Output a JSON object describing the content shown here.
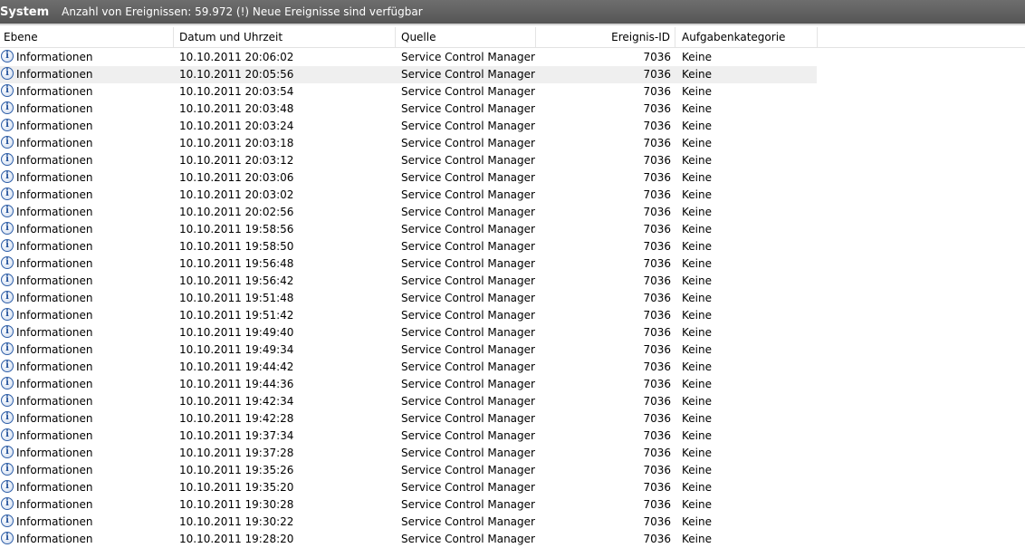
{
  "titlebar": {
    "title": "System",
    "count_text": "Anzahl von Ereignissen: 59.972 (!) Neue Ereignisse sind verfügbar"
  },
  "columns": {
    "level": "Ebene",
    "datetime": "Datum und Uhrzeit",
    "source": "Quelle",
    "event_id": "Ereignis-ID",
    "category": "Aufgabenkategorie"
  },
  "rows": [
    {
      "level": "Informationen",
      "datetime": "10.10.2011 20:06:02",
      "source": "Service Control Manager",
      "event_id": "7036",
      "category": "Keine"
    },
    {
      "level": "Informationen",
      "datetime": "10.10.2011 20:05:56",
      "source": "Service Control Manager",
      "event_id": "7036",
      "category": "Keine"
    },
    {
      "level": "Informationen",
      "datetime": "10.10.2011 20:03:54",
      "source": "Service Control Manager",
      "event_id": "7036",
      "category": "Keine"
    },
    {
      "level": "Informationen",
      "datetime": "10.10.2011 20:03:48",
      "source": "Service Control Manager",
      "event_id": "7036",
      "category": "Keine"
    },
    {
      "level": "Informationen",
      "datetime": "10.10.2011 20:03:24",
      "source": "Service Control Manager",
      "event_id": "7036",
      "category": "Keine"
    },
    {
      "level": "Informationen",
      "datetime": "10.10.2011 20:03:18",
      "source": "Service Control Manager",
      "event_id": "7036",
      "category": "Keine"
    },
    {
      "level": "Informationen",
      "datetime": "10.10.2011 20:03:12",
      "source": "Service Control Manager",
      "event_id": "7036",
      "category": "Keine"
    },
    {
      "level": "Informationen",
      "datetime": "10.10.2011 20:03:06",
      "source": "Service Control Manager",
      "event_id": "7036",
      "category": "Keine"
    },
    {
      "level": "Informationen",
      "datetime": "10.10.2011 20:03:02",
      "source": "Service Control Manager",
      "event_id": "7036",
      "category": "Keine"
    },
    {
      "level": "Informationen",
      "datetime": "10.10.2011 20:02:56",
      "source": "Service Control Manager",
      "event_id": "7036",
      "category": "Keine"
    },
    {
      "level": "Informationen",
      "datetime": "10.10.2011 19:58:56",
      "source": "Service Control Manager",
      "event_id": "7036",
      "category": "Keine"
    },
    {
      "level": "Informationen",
      "datetime": "10.10.2011 19:58:50",
      "source": "Service Control Manager",
      "event_id": "7036",
      "category": "Keine"
    },
    {
      "level": "Informationen",
      "datetime": "10.10.2011 19:56:48",
      "source": "Service Control Manager",
      "event_id": "7036",
      "category": "Keine"
    },
    {
      "level": "Informationen",
      "datetime": "10.10.2011 19:56:42",
      "source": "Service Control Manager",
      "event_id": "7036",
      "category": "Keine"
    },
    {
      "level": "Informationen",
      "datetime": "10.10.2011 19:51:48",
      "source": "Service Control Manager",
      "event_id": "7036",
      "category": "Keine"
    },
    {
      "level": "Informationen",
      "datetime": "10.10.2011 19:51:42",
      "source": "Service Control Manager",
      "event_id": "7036",
      "category": "Keine"
    },
    {
      "level": "Informationen",
      "datetime": "10.10.2011 19:49:40",
      "source": "Service Control Manager",
      "event_id": "7036",
      "category": "Keine"
    },
    {
      "level": "Informationen",
      "datetime": "10.10.2011 19:49:34",
      "source": "Service Control Manager",
      "event_id": "7036",
      "category": "Keine"
    },
    {
      "level": "Informationen",
      "datetime": "10.10.2011 19:44:42",
      "source": "Service Control Manager",
      "event_id": "7036",
      "category": "Keine"
    },
    {
      "level": "Informationen",
      "datetime": "10.10.2011 19:44:36",
      "source": "Service Control Manager",
      "event_id": "7036",
      "category": "Keine"
    },
    {
      "level": "Informationen",
      "datetime": "10.10.2011 19:42:34",
      "source": "Service Control Manager",
      "event_id": "7036",
      "category": "Keine"
    },
    {
      "level": "Informationen",
      "datetime": "10.10.2011 19:42:28",
      "source": "Service Control Manager",
      "event_id": "7036",
      "category": "Keine"
    },
    {
      "level": "Informationen",
      "datetime": "10.10.2011 19:37:34",
      "source": "Service Control Manager",
      "event_id": "7036",
      "category": "Keine"
    },
    {
      "level": "Informationen",
      "datetime": "10.10.2011 19:37:28",
      "source": "Service Control Manager",
      "event_id": "7036",
      "category": "Keine"
    },
    {
      "level": "Informationen",
      "datetime": "10.10.2011 19:35:26",
      "source": "Service Control Manager",
      "event_id": "7036",
      "category": "Keine"
    },
    {
      "level": "Informationen",
      "datetime": "10.10.2011 19:35:20",
      "source": "Service Control Manager",
      "event_id": "7036",
      "category": "Keine"
    },
    {
      "level": "Informationen",
      "datetime": "10.10.2011 19:30:28",
      "source": "Service Control Manager",
      "event_id": "7036",
      "category": "Keine"
    },
    {
      "level": "Informationen",
      "datetime": "10.10.2011 19:30:22",
      "source": "Service Control Manager",
      "event_id": "7036",
      "category": "Keine"
    },
    {
      "level": "Informationen",
      "datetime": "10.10.2011 19:28:20",
      "source": "Service Control Manager",
      "event_id": "7036",
      "category": "Keine"
    }
  ],
  "selected_row": 1,
  "level_icon": "information-icon",
  "colors": {
    "titlebar": "#5e5e5e",
    "selected_row": "#efefef",
    "icon_blue": "#2f5fa8"
  }
}
